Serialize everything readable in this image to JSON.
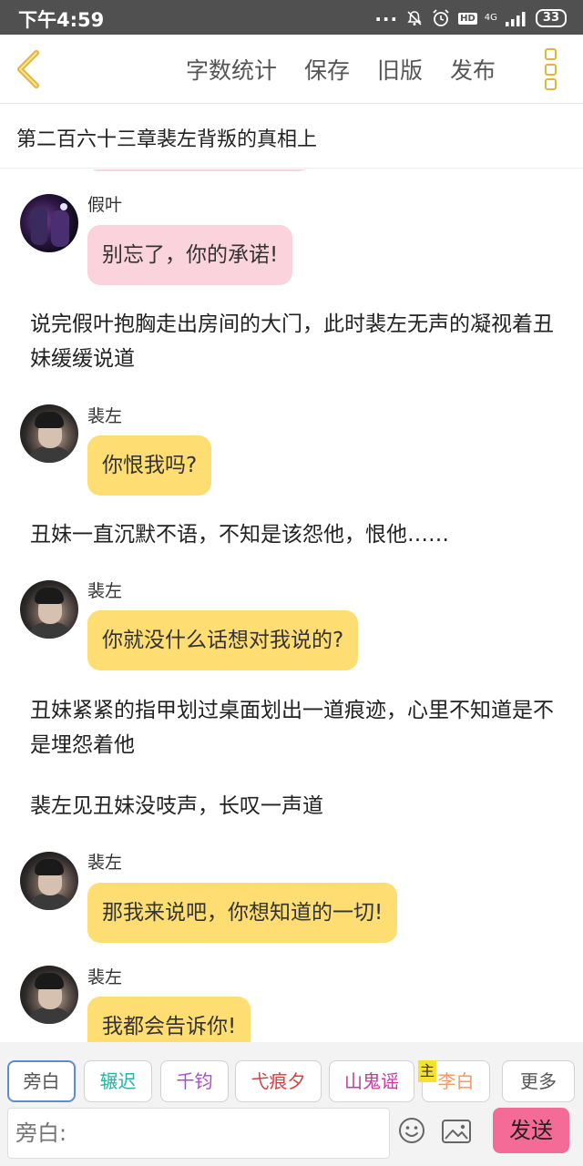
{
  "status_bar": {
    "time": "下午4:59",
    "dots": "...",
    "hd": "HD",
    "network": "4G",
    "battery": "33"
  },
  "header": {
    "back_icon": "chevron-left-icon",
    "actions": [
      "字数统计",
      "保存",
      "旧版",
      "发布"
    ],
    "menu_icon": "more-vertical-icon",
    "accent_color": "#e2b63a"
  },
  "chapter_title": "第二百六十三章裴左背叛的真相上",
  "messages": [
    {
      "type": "dialog",
      "speaker": "假叶",
      "text": "别忘了，你的承诺!",
      "color": "#fbd3dd"
    },
    {
      "type": "narration",
      "text": "说完假叶抱胸走出房间的大门，此时裴左无声的凝视着丑妹缓缓说道"
    },
    {
      "type": "dialog",
      "speaker": "裴左",
      "text": "你恨我吗?",
      "color": "#fedd73"
    },
    {
      "type": "narration",
      "text": "丑妹一直沉默不语，不知是该怨他，恨他……"
    },
    {
      "type": "dialog",
      "speaker": "裴左",
      "text": "你就没什么话想对我说的?",
      "color": "#fedd73"
    },
    {
      "type": "narration",
      "text": "丑妹紧紧的指甲划过桌面划出一道痕迹，心里不知道是不是埋怨着他"
    },
    {
      "type": "narration",
      "text": "裴左见丑妹没吱声，长叹一声道"
    },
    {
      "type": "dialog",
      "speaker": "裴左",
      "text": "那我来说吧，你想知道的一切!",
      "color": "#fedd73"
    },
    {
      "type": "dialog",
      "speaker": "裴左",
      "text": "我都会告诉你!",
      "color": "#fedd73"
    }
  ],
  "roles": [
    {
      "label": "旁白",
      "color": "#555555",
      "selected": true
    },
    {
      "label": "辗迟",
      "color": "#26b3a8"
    },
    {
      "label": "千钧",
      "color": "#a64fc9"
    },
    {
      "label": "弋痕夕",
      "color": "#d64040"
    },
    {
      "label": "山鬼谣",
      "color": "#c23aa6"
    },
    {
      "label": "李白",
      "color": "#f09a6a",
      "tag": "主"
    },
    {
      "label": "更多",
      "color": "#555555"
    }
  ],
  "input": {
    "placeholder": "旁白:",
    "emoji_icon": "emoji-icon",
    "image_icon": "image-icon",
    "send_label": "发送",
    "send_color": "#f46b98"
  }
}
